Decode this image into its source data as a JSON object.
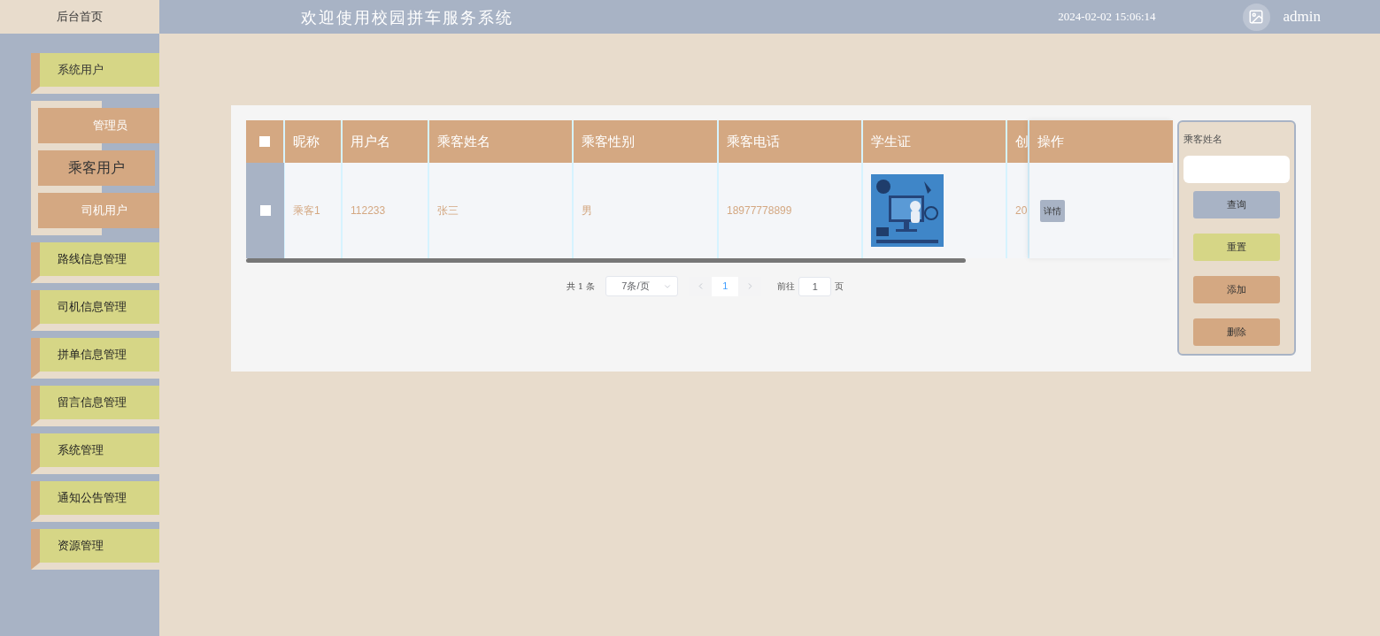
{
  "header": {
    "brand": "后台首页",
    "title": "欢迎使用校园拼车服务系统",
    "datetime": "2024-02-02 15:06:14",
    "username": "admin"
  },
  "sidebar": {
    "items": [
      {
        "label": "系统用户",
        "expanded": true,
        "children": [
          {
            "label": "管理员",
            "selected": false
          },
          {
            "label": "乘客用户",
            "selected": true
          },
          {
            "label": "司机用户",
            "selected": false
          }
        ]
      },
      {
        "label": "路线信息管理",
        "expanded": false
      },
      {
        "label": "司机信息管理",
        "expanded": false
      },
      {
        "label": "拼单信息管理",
        "expanded": false
      },
      {
        "label": "留言信息管理",
        "expanded": false
      },
      {
        "label": "系统管理",
        "expanded": false
      },
      {
        "label": "通知公告管理",
        "expanded": false
      },
      {
        "label": "资源管理",
        "expanded": false
      }
    ]
  },
  "table": {
    "select_all": {
      "checked": false
    },
    "columns": [
      "昵称",
      "用户名",
      "乘客姓名",
      "乘客性别",
      "乘客电话",
      "学生证",
      "创"
    ],
    "action_column": "操作",
    "rows": [
      {
        "checked": false,
        "cells": [
          "乘客1",
          "112233",
          "张三",
          "男",
          "18977778899",
          {
            "kind": "picture"
          },
          "20"
        ],
        "action": "详情"
      }
    ]
  },
  "pagination": {
    "total": "共 1 条",
    "page_size": "7条/页",
    "pages": [
      {
        "label": "1",
        "selected": true
      }
    ],
    "goto_label": "前往",
    "goto_value": "1",
    "goto_suffix": "页"
  },
  "search": {
    "label": "乘客姓名",
    "buttons": [
      {
        "label": "查询",
        "kind": "query"
      },
      {
        "label": "重置",
        "kind": "reset"
      },
      {
        "label": "添加",
        "kind": "add"
      },
      {
        "label": "删除",
        "kind": "delete"
      }
    ]
  }
}
